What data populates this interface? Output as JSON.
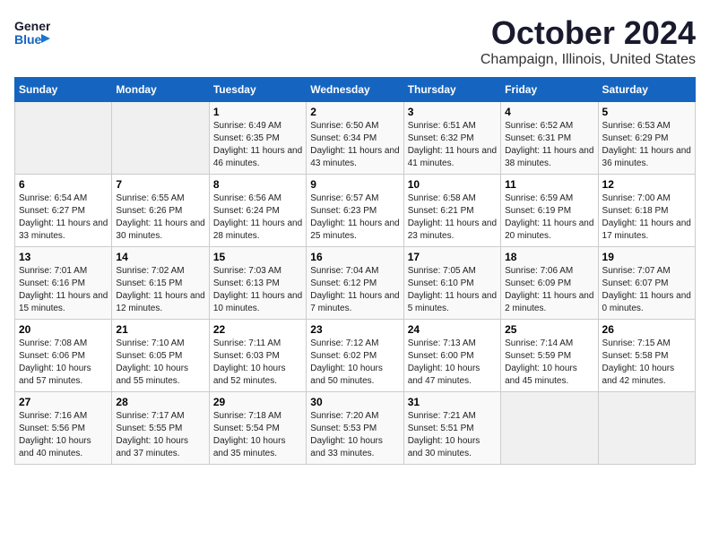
{
  "header": {
    "logo_line1": "General",
    "logo_line2": "Blue",
    "title": "October 2024",
    "subtitle": "Champaign, Illinois, United States"
  },
  "calendar": {
    "days_of_week": [
      "Sunday",
      "Monday",
      "Tuesday",
      "Wednesday",
      "Thursday",
      "Friday",
      "Saturday"
    ],
    "weeks": [
      [
        {
          "day": "",
          "info": ""
        },
        {
          "day": "",
          "info": ""
        },
        {
          "day": "1",
          "info": "Sunrise: 6:49 AM\nSunset: 6:35 PM\nDaylight: 11 hours and 46 minutes."
        },
        {
          "day": "2",
          "info": "Sunrise: 6:50 AM\nSunset: 6:34 PM\nDaylight: 11 hours and 43 minutes."
        },
        {
          "day": "3",
          "info": "Sunrise: 6:51 AM\nSunset: 6:32 PM\nDaylight: 11 hours and 41 minutes."
        },
        {
          "day": "4",
          "info": "Sunrise: 6:52 AM\nSunset: 6:31 PM\nDaylight: 11 hours and 38 minutes."
        },
        {
          "day": "5",
          "info": "Sunrise: 6:53 AM\nSunset: 6:29 PM\nDaylight: 11 hours and 36 minutes."
        }
      ],
      [
        {
          "day": "6",
          "info": "Sunrise: 6:54 AM\nSunset: 6:27 PM\nDaylight: 11 hours and 33 minutes."
        },
        {
          "day": "7",
          "info": "Sunrise: 6:55 AM\nSunset: 6:26 PM\nDaylight: 11 hours and 30 minutes."
        },
        {
          "day": "8",
          "info": "Sunrise: 6:56 AM\nSunset: 6:24 PM\nDaylight: 11 hours and 28 minutes."
        },
        {
          "day": "9",
          "info": "Sunrise: 6:57 AM\nSunset: 6:23 PM\nDaylight: 11 hours and 25 minutes."
        },
        {
          "day": "10",
          "info": "Sunrise: 6:58 AM\nSunset: 6:21 PM\nDaylight: 11 hours and 23 minutes."
        },
        {
          "day": "11",
          "info": "Sunrise: 6:59 AM\nSunset: 6:19 PM\nDaylight: 11 hours and 20 minutes."
        },
        {
          "day": "12",
          "info": "Sunrise: 7:00 AM\nSunset: 6:18 PM\nDaylight: 11 hours and 17 minutes."
        }
      ],
      [
        {
          "day": "13",
          "info": "Sunrise: 7:01 AM\nSunset: 6:16 PM\nDaylight: 11 hours and 15 minutes."
        },
        {
          "day": "14",
          "info": "Sunrise: 7:02 AM\nSunset: 6:15 PM\nDaylight: 11 hours and 12 minutes."
        },
        {
          "day": "15",
          "info": "Sunrise: 7:03 AM\nSunset: 6:13 PM\nDaylight: 11 hours and 10 minutes."
        },
        {
          "day": "16",
          "info": "Sunrise: 7:04 AM\nSunset: 6:12 PM\nDaylight: 11 hours and 7 minutes."
        },
        {
          "day": "17",
          "info": "Sunrise: 7:05 AM\nSunset: 6:10 PM\nDaylight: 11 hours and 5 minutes."
        },
        {
          "day": "18",
          "info": "Sunrise: 7:06 AM\nSunset: 6:09 PM\nDaylight: 11 hours and 2 minutes."
        },
        {
          "day": "19",
          "info": "Sunrise: 7:07 AM\nSunset: 6:07 PM\nDaylight: 11 hours and 0 minutes."
        }
      ],
      [
        {
          "day": "20",
          "info": "Sunrise: 7:08 AM\nSunset: 6:06 PM\nDaylight: 10 hours and 57 minutes."
        },
        {
          "day": "21",
          "info": "Sunrise: 7:10 AM\nSunset: 6:05 PM\nDaylight: 10 hours and 55 minutes."
        },
        {
          "day": "22",
          "info": "Sunrise: 7:11 AM\nSunset: 6:03 PM\nDaylight: 10 hours and 52 minutes."
        },
        {
          "day": "23",
          "info": "Sunrise: 7:12 AM\nSunset: 6:02 PM\nDaylight: 10 hours and 50 minutes."
        },
        {
          "day": "24",
          "info": "Sunrise: 7:13 AM\nSunset: 6:00 PM\nDaylight: 10 hours and 47 minutes."
        },
        {
          "day": "25",
          "info": "Sunrise: 7:14 AM\nSunset: 5:59 PM\nDaylight: 10 hours and 45 minutes."
        },
        {
          "day": "26",
          "info": "Sunrise: 7:15 AM\nSunset: 5:58 PM\nDaylight: 10 hours and 42 minutes."
        }
      ],
      [
        {
          "day": "27",
          "info": "Sunrise: 7:16 AM\nSunset: 5:56 PM\nDaylight: 10 hours and 40 minutes."
        },
        {
          "day": "28",
          "info": "Sunrise: 7:17 AM\nSunset: 5:55 PM\nDaylight: 10 hours and 37 minutes."
        },
        {
          "day": "29",
          "info": "Sunrise: 7:18 AM\nSunset: 5:54 PM\nDaylight: 10 hours and 35 minutes."
        },
        {
          "day": "30",
          "info": "Sunrise: 7:20 AM\nSunset: 5:53 PM\nDaylight: 10 hours and 33 minutes."
        },
        {
          "day": "31",
          "info": "Sunrise: 7:21 AM\nSunset: 5:51 PM\nDaylight: 10 hours and 30 minutes."
        },
        {
          "day": "",
          "info": ""
        },
        {
          "day": "",
          "info": ""
        }
      ]
    ]
  }
}
